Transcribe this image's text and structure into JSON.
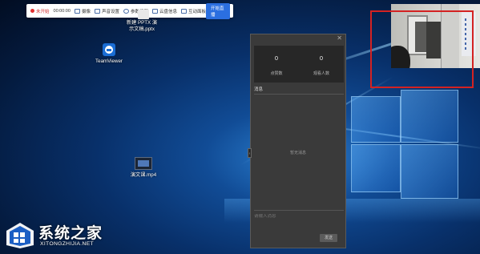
{
  "toolbar": {
    "status_label": "未开始",
    "timer": "00:00:00",
    "items": [
      {
        "label": "摄像",
        "icon": "camera-icon"
      },
      {
        "label": "声音设置",
        "icon": "sound-settings-icon"
      },
      {
        "label": "参数设置",
        "icon": "user-icon"
      },
      {
        "label": "云盘信息",
        "icon": "message-icon"
      },
      {
        "label": "互动面板",
        "icon": "panel-icon"
      }
    ],
    "start_label": "开始直播"
  },
  "desktop": {
    "icons": [
      {
        "label_line1": "新建 PPTX 演",
        "label_line2": "示文稿.pptx",
        "icon": "pptx-file-icon"
      },
      {
        "label_line1": "TeamViewer",
        "label_line2": "",
        "icon": "teamviewer-icon"
      },
      {
        "label_line1": "演文课.mp4",
        "label_line2": "",
        "icon": "mp4-file-icon"
      }
    ]
  },
  "panel": {
    "close_glyph": "✕",
    "stats": [
      {
        "value": "0",
        "label": "点赞数"
      },
      {
        "value": "0",
        "label": "观看人数"
      }
    ],
    "messages_header": "消息",
    "empty_text": "暂无消息",
    "input_placeholder": "请输入消息",
    "send_label": "发送",
    "handle_glyph": "‹"
  },
  "watermark": {
    "chinese": "系统之家",
    "english": "XITONGZHIJIA.NET"
  },
  "colors": {
    "highlight_box": "#d42222",
    "start_button": "#2b6fe0",
    "panel_bg": "#3a3a3a",
    "recording_indicator": "#e03030"
  }
}
